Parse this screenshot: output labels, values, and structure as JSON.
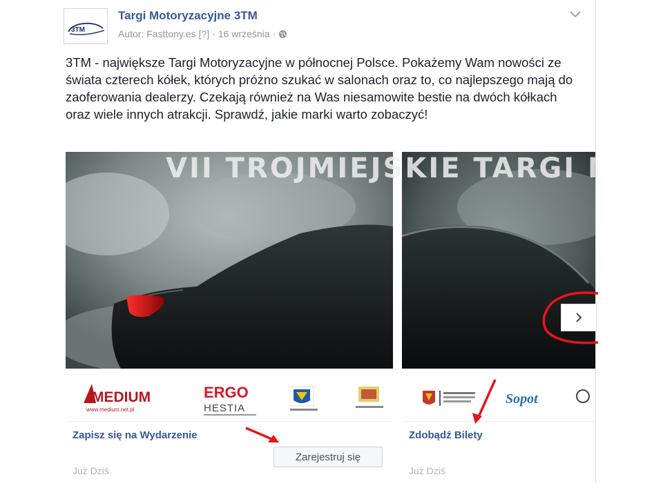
{
  "page": {
    "name": "Targi Motoryzacyjne 3TM",
    "avatar_text": "3TM",
    "author": "Autor: Fasttony.es",
    "author_help": "[?]",
    "separator": "·",
    "date": "16 września",
    "privacy_icon": "globe-icon",
    "options_icon": "chevron-down-icon"
  },
  "post": {
    "text": "3TM - największe Targi Motoryzacyjne w północnej Polsce. Pokażemy Wam nowości ze świata czterech kółek, których próżno szukać w salonach oraz to, co najlepszego mają do zaoferowania dealerzy. Czekają również na Was niesamowite bestie na dwóch kółkach oraz wiele innych atrakcji. Sprawdź, jakie marki warto zobaczyć!"
  },
  "carousel": {
    "banner_text": "VII TROJMIEJSKIE TARGI M",
    "next_icon": "chevron-right-icon",
    "cards": [
      {
        "title": "Zapisz się na Wydarzenie",
        "subtitle": "Już Dziś",
        "button": "Zarejestruj się",
        "sponsors": [
          "MEDIUM",
          "www.medium.net.pl",
          "ERGO",
          "HESTIA"
        ]
      },
      {
        "title": "Zdobądź Bilety",
        "subtitle": "Już Dziś",
        "sponsors": [
          "Sopot"
        ]
      }
    ]
  },
  "colors": {
    "link": "#365899",
    "annotation_red": "#e8141b",
    "medium_red": "#b3191e",
    "ergo_red": "#d8182b"
  }
}
